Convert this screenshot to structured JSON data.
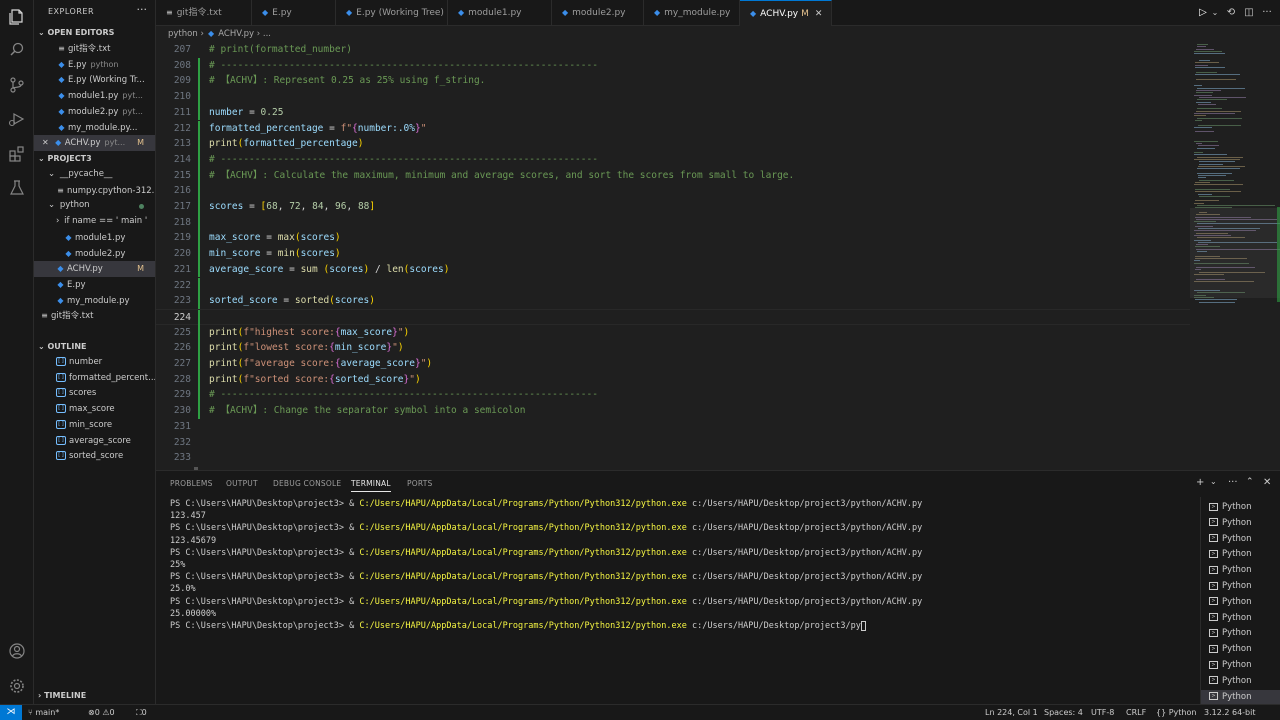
{
  "sidebar": {
    "title": "EXPLORER",
    "open_editors_label": "OPEN EDITORS",
    "open_editors": [
      {
        "name": "git指令.txt",
        "hint": "",
        "badge": ""
      },
      {
        "name": "E.py",
        "hint": "python",
        "badge": ""
      },
      {
        "name": "E.py (Working Tr...",
        "hint": "",
        "badge": ""
      },
      {
        "name": "module1.py",
        "hint": "pyt...",
        "badge": ""
      },
      {
        "name": "module2.py",
        "hint": "pyt...",
        "badge": ""
      },
      {
        "name": "my_module.py...",
        "hint": "",
        "badge": ""
      },
      {
        "name": "ACHV.py",
        "hint": "pyt...",
        "badge": "M"
      }
    ],
    "project_label": "PROJECT3",
    "project_tree": [
      {
        "name": "__pycache__"
      },
      {
        "name": "numpy.cpython-312..."
      },
      {
        "name": "python"
      },
      {
        "name": "if name == ' main '"
      },
      {
        "name": "module1.py"
      },
      {
        "name": "module2.py"
      },
      {
        "name": "ACHV.py",
        "badge": "M"
      },
      {
        "name": "E.py"
      },
      {
        "name": "my_module.py"
      },
      {
        "name": "git指令.txt"
      }
    ],
    "outline_label": "OUTLINE",
    "outline": [
      "number",
      "formatted_percent...",
      "scores",
      "max_score",
      "min_score",
      "average_score",
      "sorted_score"
    ],
    "timeline_label": "TIMELINE"
  },
  "tabs": [
    {
      "label": "git指令.txt",
      "badge": ""
    },
    {
      "label": "E.py",
      "badge": ""
    },
    {
      "label": "E.py (Working Tree)",
      "badge": ""
    },
    {
      "label": "module1.py",
      "badge": ""
    },
    {
      "label": "module2.py",
      "badge": ""
    },
    {
      "label": "my_module.py",
      "badge": ""
    },
    {
      "label": "ACHV.py",
      "badge": "M"
    }
  ],
  "breadcrumb": {
    "folder": "python",
    "file": "ACHV.py",
    "rest": "..."
  },
  "editor": {
    "current_line": "224",
    "lines": [
      {
        "num": "207",
        "text": "# print(formatted_number)"
      },
      {
        "num": "208",
        "text": "# ------------------------------------------------------------------"
      },
      {
        "num": "209",
        "text": "# 【ACHV】: Represent 0.25 as 25% using f_string."
      },
      {
        "num": "210",
        "text": ""
      },
      {
        "num": "211",
        "text": "number = 0.25"
      },
      {
        "num": "212",
        "text": "formatted_percentage = f\"{number:.0%}\""
      },
      {
        "num": "213",
        "text": "print(formatted_percentage)"
      },
      {
        "num": "214",
        "text": "# ------------------------------------------------------------------"
      },
      {
        "num": "215",
        "text": "# 【ACHV】: Calculate the maximum, minimum and average scores, and sort the scores from small to large."
      },
      {
        "num": "216",
        "text": ""
      },
      {
        "num": "217",
        "text": "scores = [68, 72, 84, 96, 88]"
      },
      {
        "num": "218",
        "text": ""
      },
      {
        "num": "219",
        "text": "max_score = max(scores)"
      },
      {
        "num": "220",
        "text": "min_score = min(scores)"
      },
      {
        "num": "221",
        "text": "average_score = sum (scores) / len(scores)"
      },
      {
        "num": "222",
        "text": ""
      },
      {
        "num": "223",
        "text": "sorted_score = sorted(scores)"
      },
      {
        "num": "224",
        "text": ""
      },
      {
        "num": "225",
        "text": "print(f\"highest score:{max_score}\")"
      },
      {
        "num": "226",
        "text": "print(f\"lowest score:{min_score}\")"
      },
      {
        "num": "227",
        "text": "print(f\"average score:{average_score}\")"
      },
      {
        "num": "228",
        "text": "print(f\"sorted score:{sorted_score}\")"
      },
      {
        "num": "229",
        "text": "# ------------------------------------------------------------------"
      },
      {
        "num": "230",
        "text": "# 【ACHV】: Change the separator symbol into a semicolon"
      },
      {
        "num": "231",
        "text": ""
      },
      {
        "num": "232",
        "text": ""
      },
      {
        "num": "233",
        "text": ""
      }
    ]
  },
  "panel": {
    "tabs": [
      "PROBLEMS",
      "OUTPUT",
      "DEBUG CONSOLE",
      "TERMINAL",
      "PORTS"
    ],
    "active_tab": "TERMINAL",
    "terminal": [
      {
        "prompt": "PS C:\\Users\\HAPU\\Desktop\\project3> & ",
        "exe": "C:/Users/HAPU/AppData/Local/Programs/Python/Python312/python.exe",
        "arg": " c:/Users/HAPU/Desktop/project3/python/ACHV.py"
      },
      {
        "out": "123.457"
      },
      {
        "prompt": "PS C:\\Users\\HAPU\\Desktop\\project3> & ",
        "exe": "C:/Users/HAPU/AppData/Local/Programs/Python/Python312/python.exe",
        "arg": " c:/Users/HAPU/Desktop/project3/python/ACHV.py"
      },
      {
        "out": "123.45679"
      },
      {
        "prompt": "PS C:\\Users\\HAPU\\Desktop\\project3> & ",
        "exe": "C:/Users/HAPU/AppData/Local/Programs/Python/Python312/python.exe",
        "arg": " c:/Users/HAPU/Desktop/project3/python/ACHV.py"
      },
      {
        "out": "25%"
      },
      {
        "prompt": "PS C:\\Users\\HAPU\\Desktop\\project3> & ",
        "exe": "C:/Users/HAPU/AppData/Local/Programs/Python/Python312/python.exe",
        "arg": " c:/Users/HAPU/Desktop/project3/python/ACHV.py"
      },
      {
        "out": "25.0%"
      },
      {
        "prompt": "PS C:\\Users\\HAPU\\Desktop\\project3> & ",
        "exe": "C:/Users/HAPU/AppData/Local/Programs/Python/Python312/python.exe",
        "arg": " c:/Users/HAPU/Desktop/project3/python/ACHV.py"
      },
      {
        "out": "25.00000%"
      },
      {
        "prompt": "PS C:\\Users\\HAPU\\Desktop\\project3> & ",
        "exe": "C:/Users/HAPU/AppData/Local/Programs/Python/Python312/python.exe",
        "arg": " c:/Users/HAPU/Desktop/project3/py",
        "cursor": true
      }
    ],
    "terminal_instances": [
      "Python",
      "Python",
      "Python",
      "Python",
      "Python",
      "Python",
      "Python",
      "Python",
      "Python",
      "Python",
      "Python",
      "Python",
      "Python"
    ]
  },
  "status": {
    "branch": "main*",
    "errors": "0",
    "warnings": "0",
    "ports": "0",
    "position": "Ln 224, Col 1",
    "spaces": "Spaces: 4",
    "encoding": "UTF-8",
    "eol": "CRLF",
    "language": "Python",
    "interpreter": "3.12.2 64-bit"
  },
  "colors": {
    "accent": "#0078d4",
    "modified": "#e2c08d",
    "gutter_added": "#2ea043"
  }
}
